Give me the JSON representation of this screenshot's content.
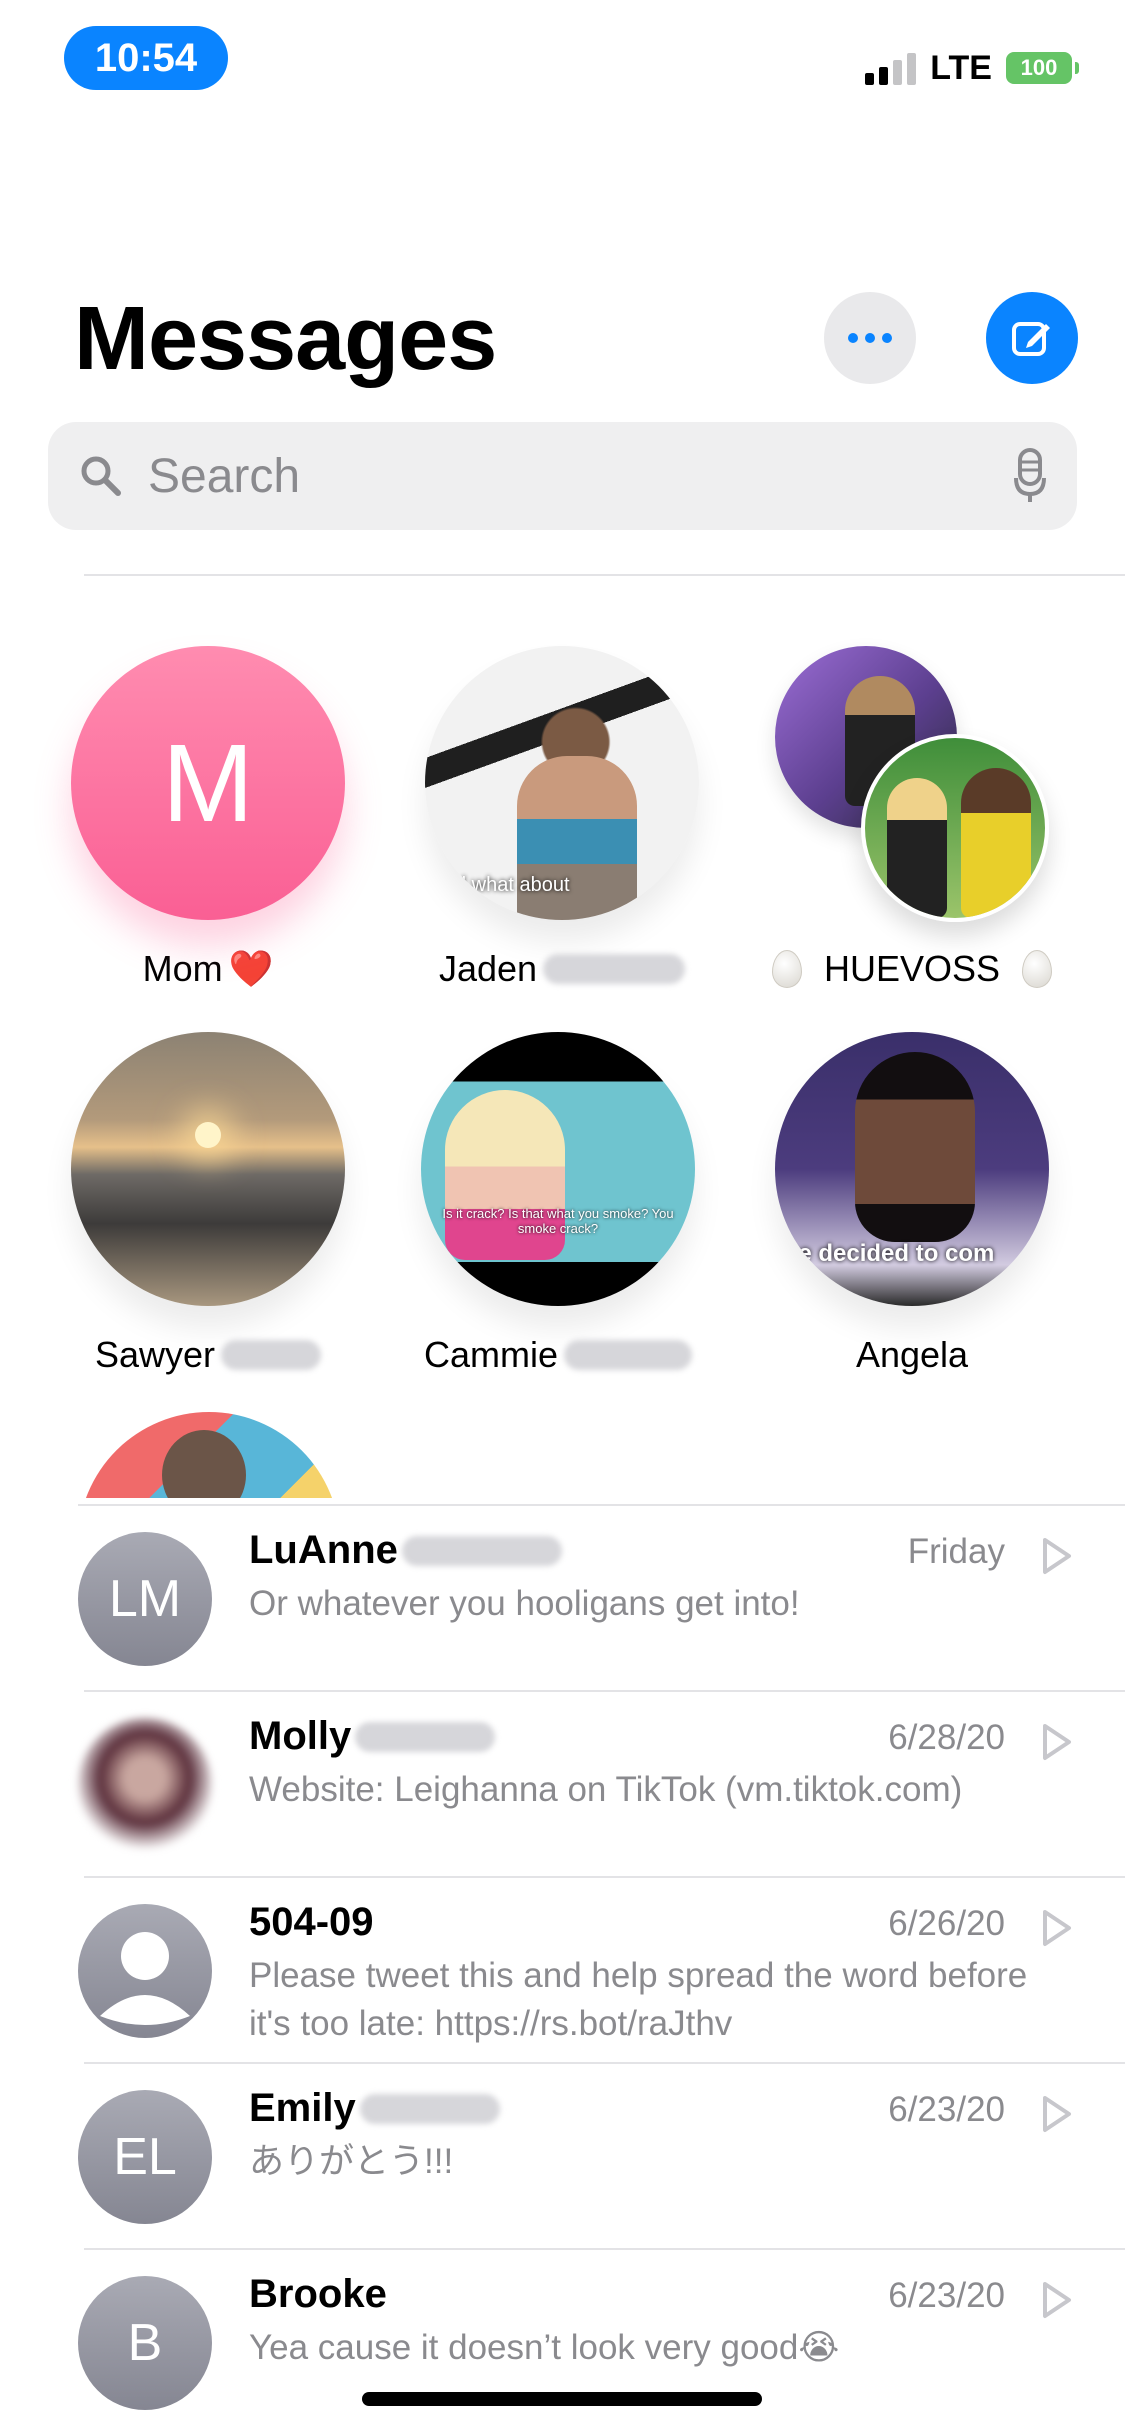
{
  "status_bar": {
    "time": "10:54",
    "network": "LTE",
    "battery": "100"
  },
  "header": {
    "title": "Messages",
    "more_icon": "ellipsis-icon",
    "compose_icon": "compose-icon"
  },
  "search": {
    "placeholder": "Search",
    "search_icon": "magnifier-icon",
    "mic_icon": "microphone-icon"
  },
  "pinned": [
    {
      "name": "Mom",
      "emoji": "❤️",
      "initial": "M"
    },
    {
      "name": "Jaden"
    },
    {
      "name": "HUEVOSS"
    },
    {
      "name": "Sawyer"
    },
    {
      "name": "Cammie"
    },
    {
      "name": "Angela"
    }
  ],
  "pinned_captions": {
    "jaden": "d what about",
    "cammie": "Is it crack? Is that what you smoke? You smoke crack?",
    "angela": "ve decided to com"
  },
  "conversations": [
    {
      "sender": "LuAnne",
      "initials": "LM",
      "date": "Friday",
      "preview": "Or whatever you hooligans get into!"
    },
    {
      "sender": "Molly",
      "initials": "",
      "date": "6/28/20",
      "preview": "Website: Leighanna on TikTok (vm.tiktok.com)"
    },
    {
      "sender": "504-09",
      "initials": "",
      "date": "6/26/20",
      "preview": "Please tweet this and help spread the word before it's too late: https://rs.bot/raJthv"
    },
    {
      "sender": "Emily",
      "initials": "EL",
      "date": "6/23/20",
      "preview": "ありがとう!!!"
    },
    {
      "sender": "Brooke",
      "initials": "B",
      "date": "6/23/20",
      "preview": "Yea cause it doesn’t look very good😭"
    }
  ],
  "colors": {
    "accent": "#0a84ff",
    "battery": "#65c466",
    "secondary_text": "#8a8a8e"
  }
}
